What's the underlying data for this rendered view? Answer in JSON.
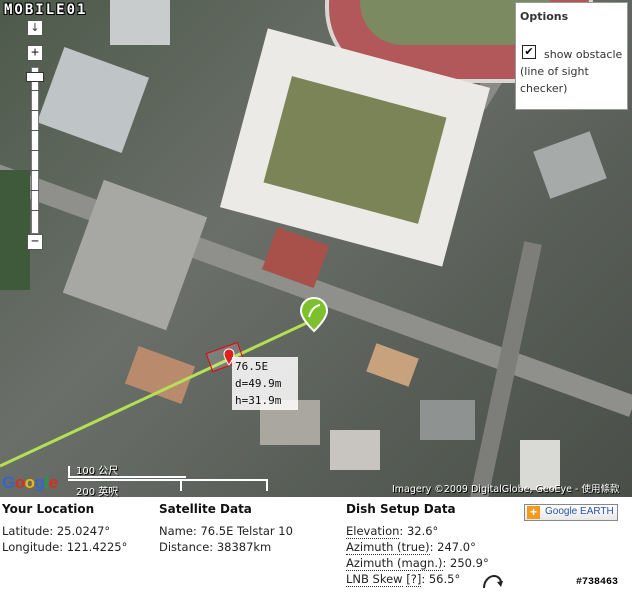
{
  "map": {
    "logo": "MOBILE01",
    "zoom_in": "+",
    "zoom_out": "−",
    "pan_down": "↓",
    "options": {
      "title": "Options",
      "checkbox_mark": "✔",
      "label": "show obstacle (line of sight checker)",
      "checked": true
    },
    "popup": {
      "satellite": "76.5E",
      "distance": "d=49.9m",
      "height": "h=31.9m"
    },
    "scale": {
      "metric": "100 公尺",
      "imperial": "200 英呎"
    },
    "google_logo": [
      "G",
      "o",
      "o",
      "g",
      "l",
      "e"
    ],
    "google_colors": [
      "#3366cc",
      "#d62d20",
      "#f2b60b",
      "#3366cc",
      "#229943",
      "#d62d20"
    ],
    "copyright": "Imagery ©2009 DigitalGlobe, GeoEye - 使用條款",
    "line_color": "#b5e053",
    "marker_color": "#e01f1f",
    "pin_color": "#7cc12b"
  },
  "panel": {
    "location": {
      "title": "Your Location",
      "latitude": "Latitude: 25.0247°",
      "longitude": "Longitude: 121.4225°"
    },
    "satellite": {
      "title": "Satellite Data",
      "name": "Name: 76.5E Telstar 10",
      "distance": "Distance: 38387km"
    },
    "dish": {
      "title": "Dish Setup Data",
      "elevation_label": "Elevation",
      "elevation_value": ": 32.6°",
      "azimuth_true_label": "Azimuth (true)",
      "azimuth_true_value": ": 247.0°",
      "azimuth_magn_label": "Azimuth (magn.)",
      "azimuth_magn_value": ": 250.9°",
      "lnb_label": "LNB Skew",
      "lnb_help": "[?]",
      "lnb_value": ": 56.5°"
    },
    "google_earth": {
      "plus": "+",
      "label": "Google EARTH"
    },
    "image_id": "#738463"
  }
}
